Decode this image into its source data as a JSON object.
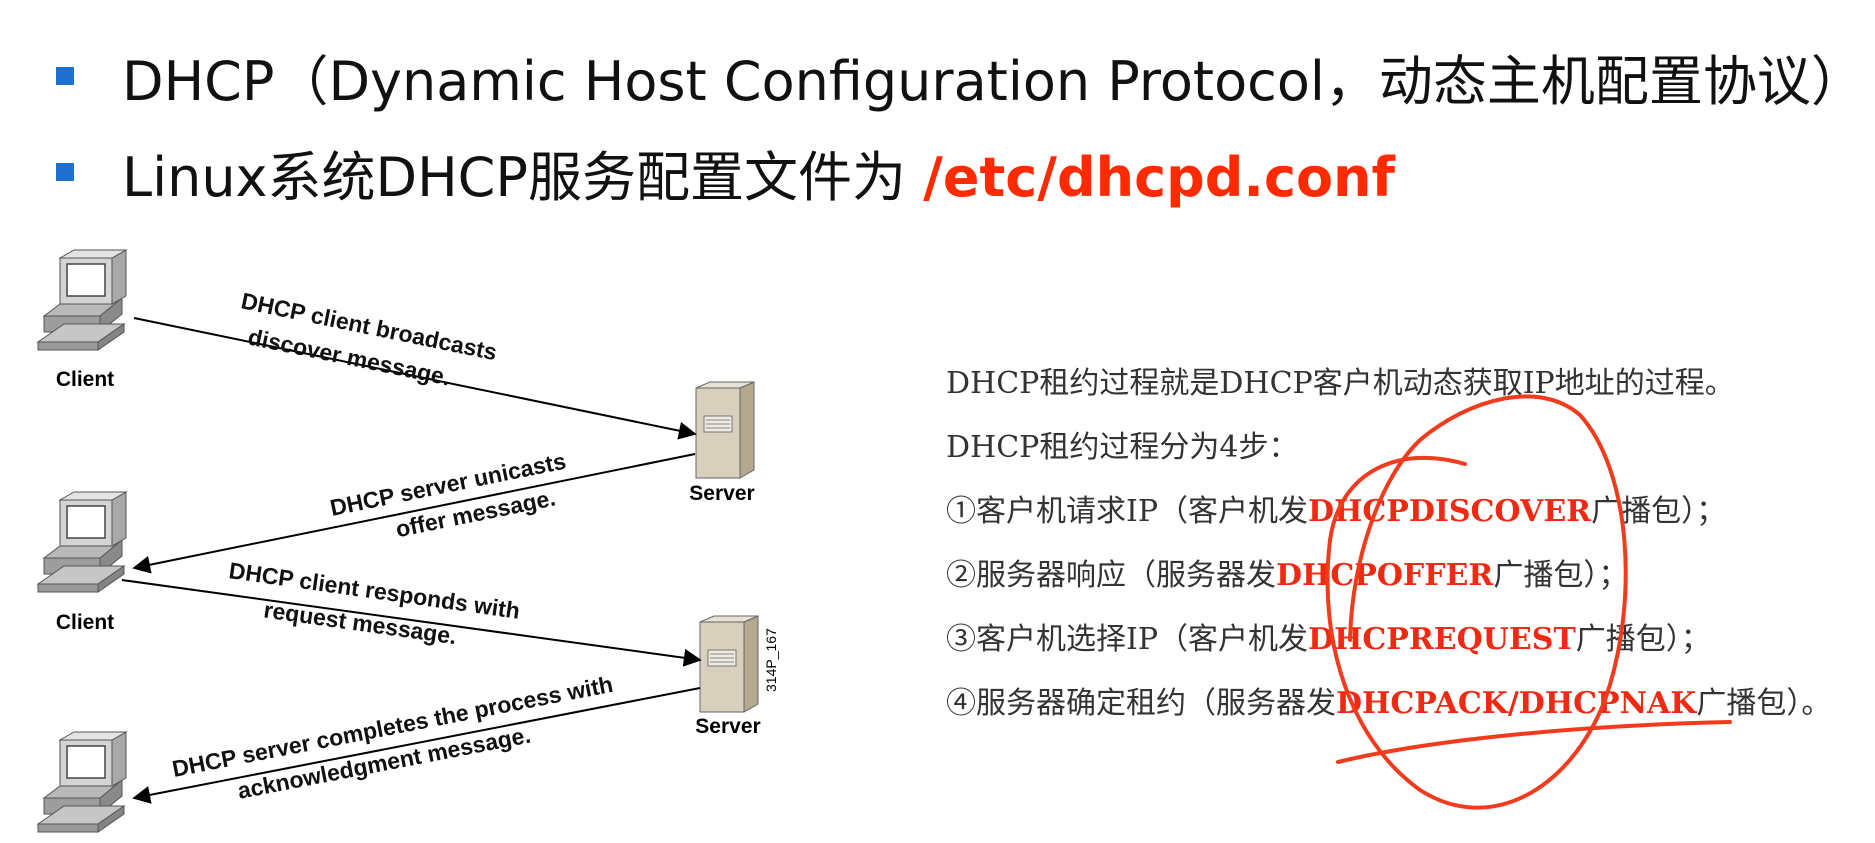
{
  "bullets": [
    {
      "text": "DHCP（Dynamic Host Configuration Protocol，动态主机配置协议）"
    },
    {
      "text": "Linux系统DHCP服务配置文件为 ",
      "highlight": "/etc/dhcpd.conf"
    }
  ],
  "diagram": {
    "client_label": "Client",
    "server_label": "Server",
    "figure_code": "314P_167",
    "messages": [
      {
        "line1": "DHCP client broadcasts",
        "line2": "discover message."
      },
      {
        "line1": "DHCP server unicasts",
        "line2": "offer message."
      },
      {
        "line1": "DHCP client responds with",
        "line2": "request message."
      },
      {
        "line1": "DHCP server completes the process with",
        "line2": "acknowledgment message."
      }
    ]
  },
  "notes": {
    "line1": "DHCP租约过程就是DHCP客户机动态获取IP地址的过程。",
    "line2": "DHCP租约过程分为4步：",
    "steps": [
      {
        "pre": "①客户机请求IP（客户机发",
        "msg": "DHCPDISCOVER",
        "post": "广播包）；"
      },
      {
        "pre": "②服务器响应（服务器发",
        "msg": "DHCPOFFER",
        "post": "广播包）；"
      },
      {
        "pre": "③客户机选择IP（客户机发",
        "msg": "DHCPREQUEST",
        "post": "广播包）；"
      },
      {
        "pre": "④服务器确定租约（服务器发",
        "msg": "DHCPACK/DHCPNAK",
        "post": "广播包）。"
      }
    ]
  },
  "colors": {
    "bullet": "#1e6fd0",
    "accent": "#ff2a00",
    "message": "#f02a12",
    "annotation": "#f23a1c"
  }
}
